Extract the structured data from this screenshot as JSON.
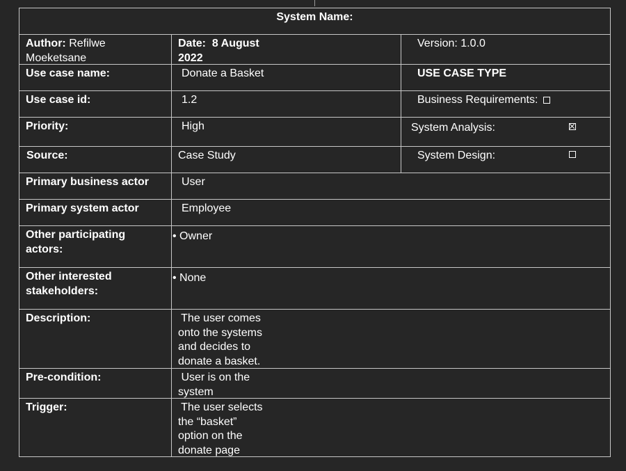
{
  "header": {
    "title": "System Name:"
  },
  "meta": {
    "author_label": "Author:",
    "author_line1": "Refilwe",
    "author_line2": "Moeketsane",
    "date_label": "Date:",
    "date_line1": "8 August",
    "date_line2": "2022",
    "version": "Version: 1.0.0"
  },
  "rows": {
    "use_case_name": {
      "label": "Use case name:",
      "value": "Donate a Basket"
    },
    "use_case_id": {
      "label": "Use case id:",
      "value": "1.2"
    },
    "priority": {
      "label": "Priority:",
      "value": "High"
    },
    "source": {
      "label": "Source:",
      "value": "Case Study"
    },
    "primary_business_actor": {
      "label": "Primary business actor",
      "value": "User"
    },
    "primary_system_actor": {
      "label": "Primary system actor",
      "value": "Employee"
    },
    "other_participating": {
      "label_line1": "Other participating",
      "label_line2": "actors:",
      "value": "• Owner"
    },
    "other_interested": {
      "label_line1": "Other interested",
      "label_line2": "stakeholders:",
      "value": "• None"
    },
    "description": {
      "label": "Description:",
      "lines": [
        " The user comes",
        "onto the systems",
        "and decides to",
        "donate a basket."
      ]
    },
    "precondition": {
      "label": "Pre-condition:",
      "lines": [
        " User is on the",
        "system"
      ]
    },
    "trigger": {
      "label": "Trigger:",
      "lines": [
        " The user selects",
        "the “basket”",
        "option on the",
        "donate page"
      ]
    }
  },
  "use_case_type": {
    "heading": "USE CASE TYPE",
    "business_requirements": {
      "label": "Business Requirements:",
      "checked": false
    },
    "system_analysis": {
      "label": "System Analysis:",
      "checked": true
    },
    "system_design": {
      "label": "System Design:",
      "checked": false
    }
  }
}
